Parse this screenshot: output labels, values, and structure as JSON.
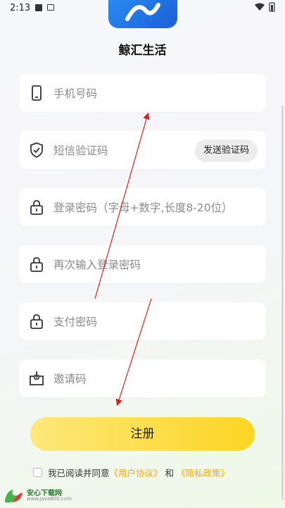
{
  "status_bar": {
    "time": "2:13"
  },
  "app": {
    "name": "鲸汇生活"
  },
  "form": {
    "phone_placeholder": "手机号码",
    "sms_placeholder": "短信验证码",
    "send_code_label": "发送验证码",
    "password_placeholder": "登录密码（字母+数字,长度8-20位）",
    "confirm_password_placeholder": "再次输入登录密码",
    "pay_password_placeholder": "支付密码",
    "invite_placeholder": "邀请码"
  },
  "register_label": "注册",
  "agreement": {
    "prefix": "我已阅读并同意",
    "user_agreement": "《用户协议》",
    "and": "和",
    "privacy_policy": "《隐私政策》"
  },
  "watermark": {
    "title": "安心下载网",
    "url": "www.java800.com"
  },
  "colors": {
    "accent": "#fdd524",
    "link": "#f1a81d",
    "annotation": "#e02020",
    "logo": "#1a5fd6"
  },
  "icons": [
    "phone-icon",
    "shield-icon",
    "lock-icon",
    "lock-icon",
    "lock-icon",
    "inbox-icon"
  ]
}
